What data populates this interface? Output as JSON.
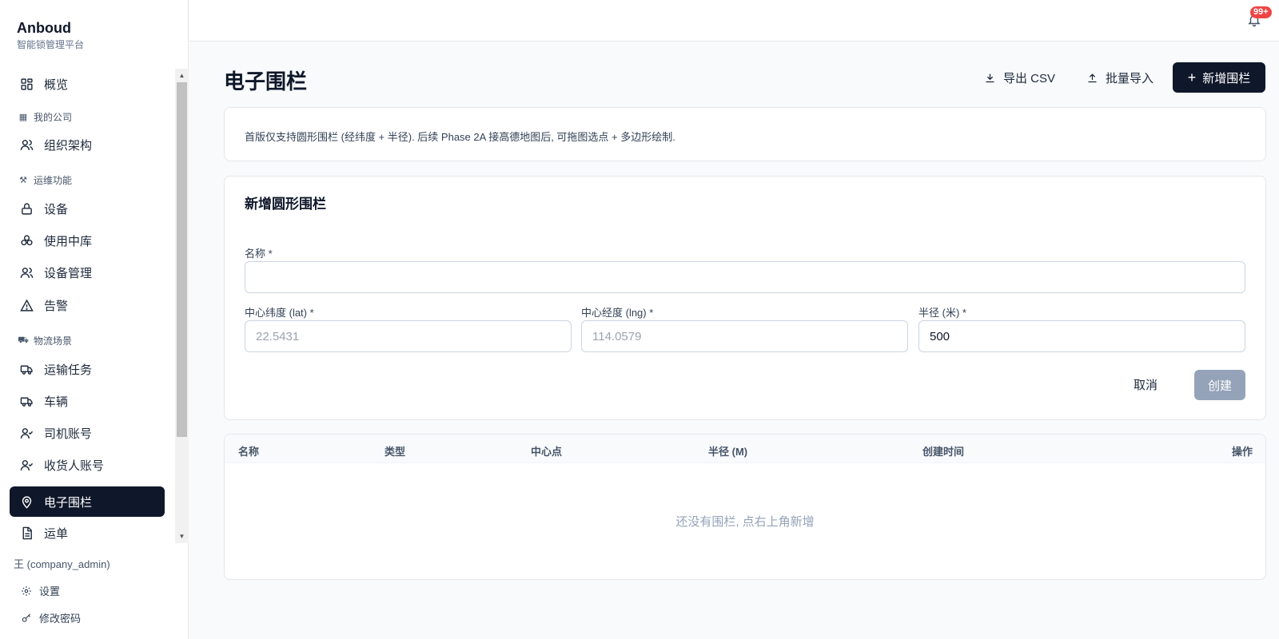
{
  "brand": {
    "name": "Anboud",
    "subtitle": "智能锁管理平台"
  },
  "sidebar": {
    "overview": "概览",
    "section_company": {
      "icon": "building-icon",
      "label": "我的公司"
    },
    "org": "组织架构",
    "section_ops": {
      "icon": "wrench-icon",
      "label": "运维功能"
    },
    "devices": "设备",
    "usage_center": "使用中库",
    "device_mgmt": "设备管理",
    "alarms": "告警",
    "section_logistics": {
      "icon": "truck-icon",
      "label": "物流场景"
    },
    "transport_tasks": "运输任务",
    "vehicles": "车辆",
    "driver_accounts": "司机账号",
    "consignee_accounts": "收货人账号",
    "geofence": "电子围栏",
    "waybill": "运单"
  },
  "user": {
    "name": "王 (company_admin)",
    "settings": "设置",
    "change_password": "修改密码"
  },
  "topbar": {
    "notification_badge": "99+"
  },
  "page": {
    "title": "电子围栏",
    "export_csv": "导出 CSV",
    "batch_import": "批量导入",
    "new_fence": "新增围栏"
  },
  "notice": {
    "text": "首版仅支持圆形围栏 (经纬度 + 半径). 后续 Phase 2A 接高德地图后, 可拖图选点 + 多边形绘制."
  },
  "form": {
    "title": "新增圆形围栏",
    "name_label": "名称 *",
    "name_value": "",
    "lat_label": "中心纬度 (lat) *",
    "lat_placeholder": "22.5431",
    "lng_label": "中心经度 (lng) *",
    "lng_placeholder": "114.0579",
    "radius_label": "半径 (米) *",
    "radius_value": "500",
    "cancel": "取消",
    "create": "创建"
  },
  "table": {
    "columns": [
      "名称",
      "类型",
      "中心点",
      "半径 (M)",
      "创建时间",
      "操作"
    ],
    "empty_text": "还没有围栏, 点右上角新增"
  },
  "colors": {
    "primary": "#0f172a",
    "disabled_button": "#94a3b8",
    "badge": "#ef4444"
  }
}
